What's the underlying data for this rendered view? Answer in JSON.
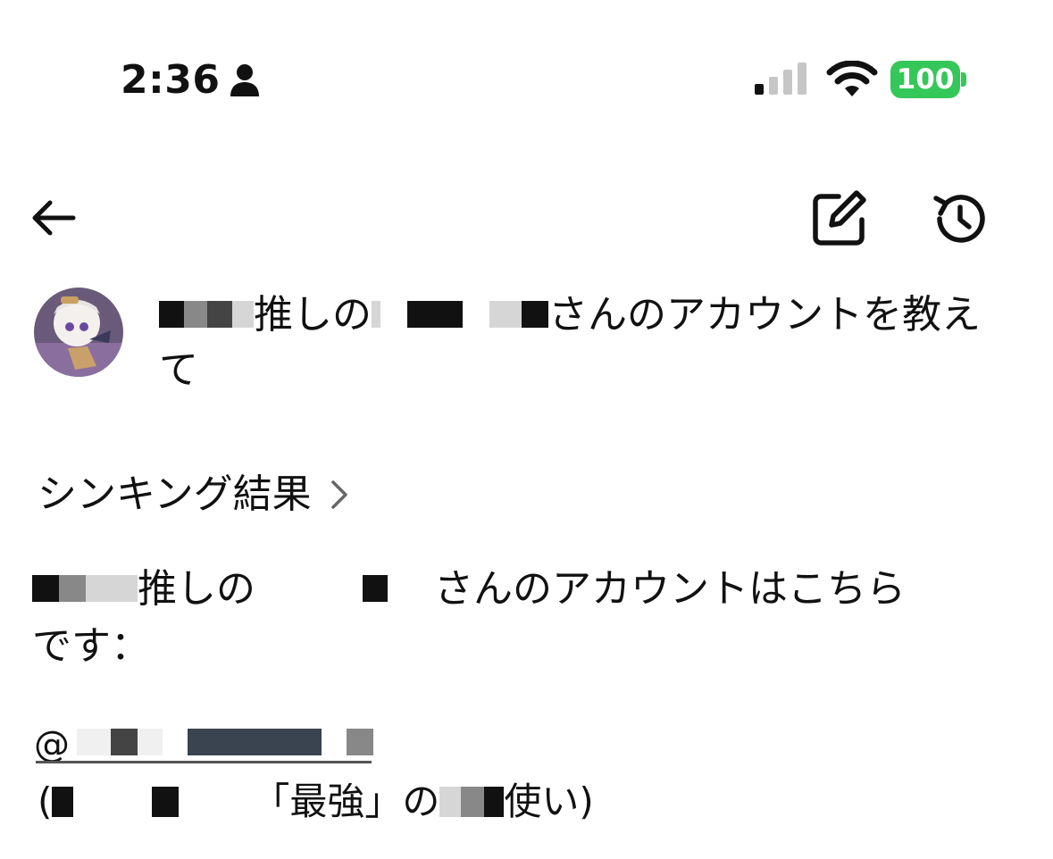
{
  "status_bar": {
    "time": "2:36",
    "battery": "100",
    "battery_color": "#34c759"
  },
  "nav": {
    "back_icon": "arrow-left-icon",
    "edit_icon": "edit-icon",
    "history_icon": "history-icon"
  },
  "user_message": {
    "part1": "推しの",
    "part2": "さんのアカウントを教え",
    "part3": "て"
  },
  "thinking": {
    "label": "シンキング結果"
  },
  "answer": {
    "part1": "推しの",
    "part2": "さんのアカウントはこちら",
    "part3": "です："
  },
  "handle": {
    "prefix": "@"
  },
  "note": {
    "open": "(",
    "middle": "「最強」の",
    "end": "使い)"
  }
}
